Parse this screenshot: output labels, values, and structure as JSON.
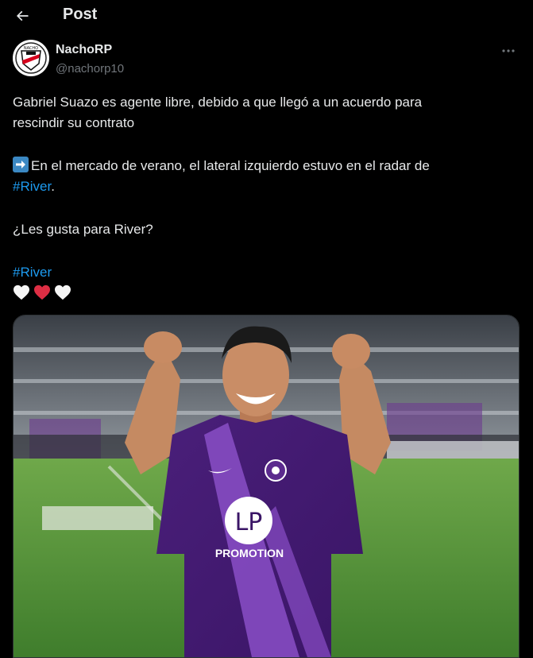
{
  "header": {
    "title": "Post"
  },
  "author": {
    "name": "NachoRP",
    "handle": "@nachorp10"
  },
  "tweet": {
    "line1": "Gabriel Suazo es agente libre, debido a que llegó a un acuerdo para",
    "line2": "rescindir  su contrato",
    "line3": "En el mercado de verano, el lateral izquierdo estuvo en el radar de",
    "hashtag1": "#River",
    "line4_suffix": ".",
    "line5": "¿Les gusta para River?",
    "hashtag2": "#River"
  },
  "media": {
    "shirt_sponsor": "LP",
    "shirt_sponsor_sub": "PROMOTION"
  },
  "icons": {
    "back": "arrow-left-icon",
    "more": "more-horizontal-icon",
    "arrow_emoji": "right-arrow-emoji-icon",
    "hearts": [
      "white-heart-icon",
      "red-heart-icon",
      "white-heart-icon"
    ]
  },
  "colors": {
    "background": "#000000",
    "text": "#e7e9ea",
    "secondary_text": "#71767b",
    "link": "#1d9bf0",
    "jersey": "#5b2a8e"
  }
}
